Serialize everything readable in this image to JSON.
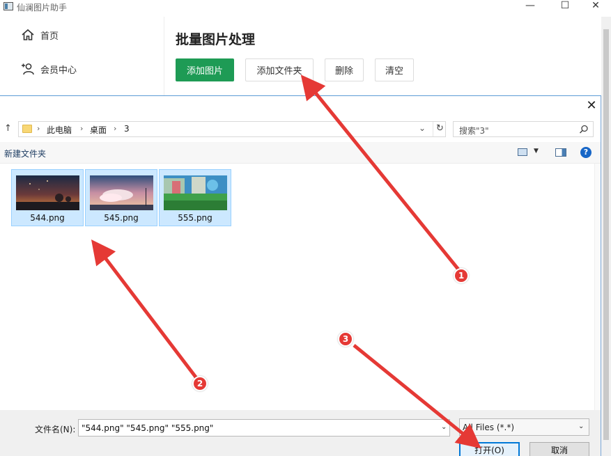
{
  "window": {
    "title": "仙澜图片助手",
    "min_glyph": "—",
    "max_glyph": "☐",
    "close_glyph": "✕"
  },
  "sidebar": {
    "items": [
      {
        "label": "首页",
        "icon": "home-icon"
      },
      {
        "label": "会员中心",
        "icon": "user-add-icon"
      }
    ]
  },
  "main": {
    "title": "批量图片处理",
    "buttons": {
      "add_image": "添加图片",
      "add_folder": "添加文件夹",
      "delete": "删除",
      "clear": "清空"
    }
  },
  "dialog": {
    "close_glyph": "✕",
    "up_glyph": "↑",
    "breadcrumb": [
      "此电脑",
      "桌面",
      "3"
    ],
    "search_placeholder": "搜索\"3\"",
    "new_folder": "新建文件夹",
    "help_glyph": "?",
    "files": [
      {
        "name": "544.png"
      },
      {
        "name": "545.png"
      },
      {
        "name": "555.png"
      }
    ],
    "filename_label": "文件名(N):",
    "filename_value": "\"544.png\" \"545.png\" \"555.png\"",
    "filter_value": "All Files (*.*)",
    "open_label": "打开(O)",
    "cancel_label": "取消"
  },
  "annotations": {
    "markers": [
      "1",
      "2",
      "3"
    ],
    "color": "#e53935"
  },
  "colors": {
    "accent_green": "#1e9b55",
    "selection_blue": "#cce8ff",
    "focus_blue": "#0078d7"
  }
}
